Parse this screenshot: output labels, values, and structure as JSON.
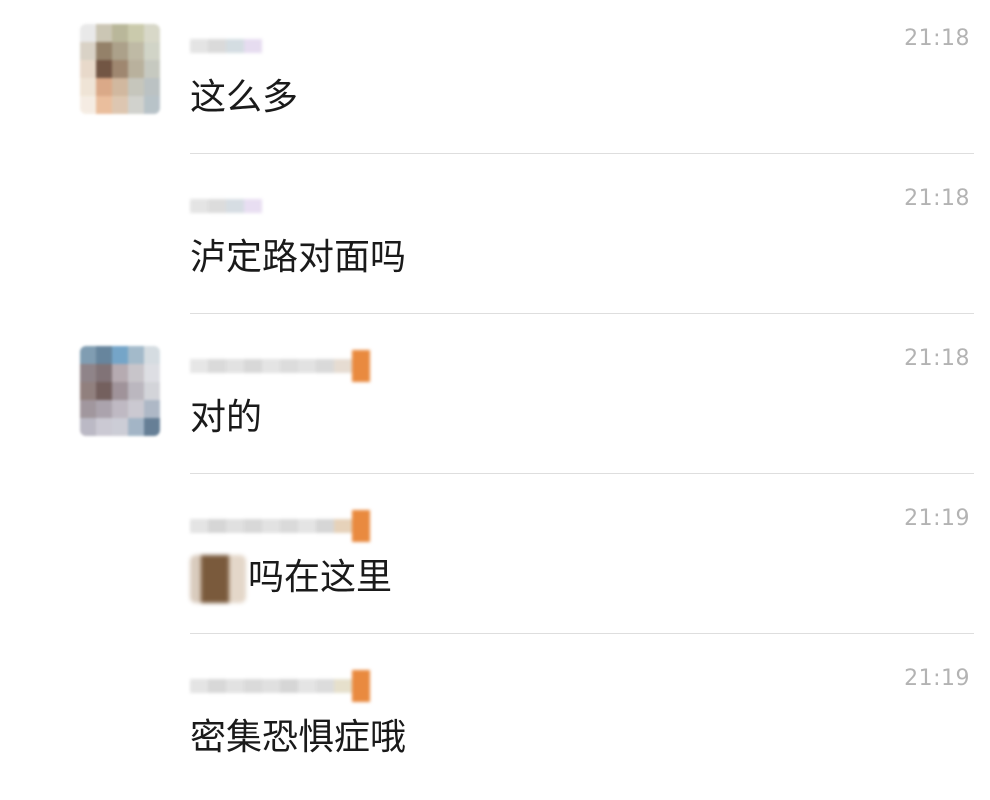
{
  "messages": [
    {
      "time": "21:18",
      "text": "这么多",
      "has_avatar": true
    },
    {
      "time": "21:18",
      "text": "泸定路对面吗",
      "has_avatar": false
    },
    {
      "time": "21:18",
      "text": "对的",
      "has_avatar": true
    },
    {
      "time": "21:19",
      "text": "吗在这里",
      "has_avatar": false,
      "prefix_obscured": true
    },
    {
      "time": "21:19",
      "text": "密集恐惧症哦",
      "has_avatar": false
    }
  ]
}
